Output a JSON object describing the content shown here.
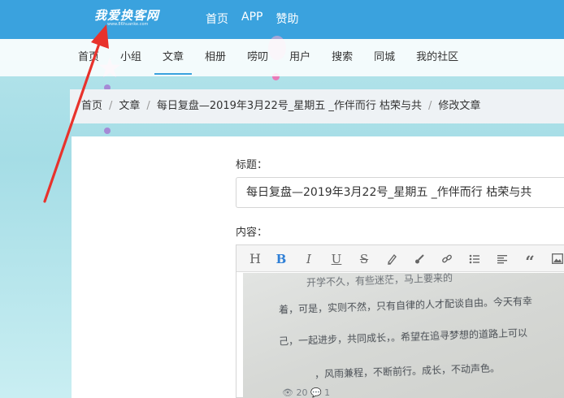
{
  "header": {
    "logo_text": "我爱换客网",
    "logo_sub": "www.86huanke.com",
    "nav": [
      "首页",
      "APP",
      "赞助"
    ]
  },
  "subnav": {
    "items": [
      "首页",
      "小组",
      "文章",
      "相册",
      "唠叨",
      "用户",
      "搜索",
      "同城",
      "我的社区"
    ],
    "active": "文章"
  },
  "breadcrumb": [
    "首页",
    "文章",
    "每日复盘—2019年3月22号_星期五 _作伴而行 枯荣与共",
    "修改文章"
  ],
  "form": {
    "title_label": "标题：",
    "title_value": "每日复盘—2019年3月22号_星期五 _作伴而行 枯荣与共",
    "content_label": "内容："
  },
  "editor": {
    "toolbar": [
      "heading-icon",
      "bold-icon",
      "italic-icon",
      "underline-icon",
      "strikethrough-icon",
      "highlighter-icon",
      "brush-icon",
      "link-icon",
      "list-icon",
      "align-icon",
      "quote-icon",
      "image-icon"
    ],
    "photo_lines": [
      "开学不久，有些迷茫，马上要来的",
      "着，可是，实则不然，只有自律的人才配谈自由。今天有幸",
      "己，一起进步，共同成长，。希望在追寻梦想的道路上可以",
      "，风雨兼程，不断前行。成长，不动声色。"
    ],
    "photo_meta": "👁 20   💬 1"
  },
  "colors": {
    "header_bg": "#3aa2de",
    "active_underline": "#3aa2de",
    "arrow": "#e8322c"
  }
}
